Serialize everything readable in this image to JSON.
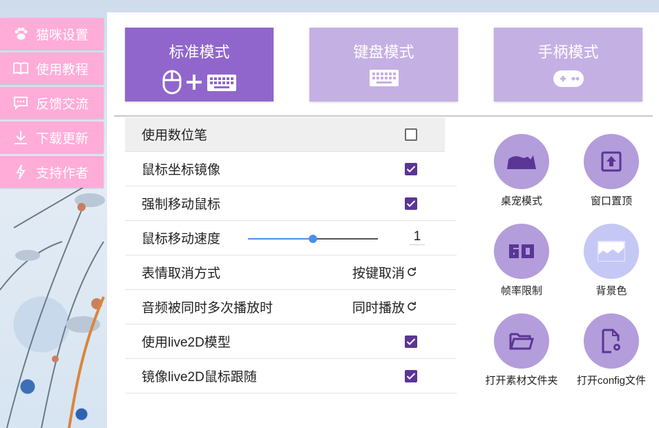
{
  "sidebar": {
    "items": [
      {
        "label": "猫咪设置",
        "icon": "paw-icon"
      },
      {
        "label": "使用教程",
        "icon": "book-icon"
      },
      {
        "label": "反馈交流",
        "icon": "chat-icon"
      },
      {
        "label": "下载更新",
        "icon": "download-icon"
      },
      {
        "label": "支持作者",
        "icon": "lightning-icon"
      }
    ]
  },
  "modes": [
    {
      "label": "标准模式",
      "icon": "mouse-plus-keyboard-icon",
      "state": "active"
    },
    {
      "label": "键盘模式",
      "icon": "keyboard-icon",
      "state": "inactive"
    },
    {
      "label": "手柄模式",
      "icon": "gamepad-icon",
      "state": "inactive"
    }
  ],
  "settings": {
    "pen": {
      "label": "使用数位笔",
      "checked": false
    },
    "mirror": {
      "label": "鼠标坐标镜像",
      "checked": true
    },
    "force_move": {
      "label": "强制移动鼠标",
      "checked": true
    },
    "speed": {
      "label": "鼠标移动速度",
      "value": "1",
      "slider_fraction": 0.5
    },
    "emote_cancel": {
      "label": "表情取消方式",
      "value": "按键取消"
    },
    "audio": {
      "label": "音频被同时多次播放时",
      "value": "同时播放"
    },
    "live2d": {
      "label": "使用live2D模型",
      "checked": true
    },
    "live2d_mirror": {
      "label": "镜像live2D鼠标跟随",
      "checked": true
    }
  },
  "tools": [
    {
      "label": "桌宠模式",
      "icon": "cat-silhouette-icon"
    },
    {
      "label": "窗口置顶",
      "icon": "pin-top-icon"
    },
    {
      "label": "帧率限制",
      "icon": "fps-60-icon"
    },
    {
      "label": "背景色",
      "icon": "image-icon"
    },
    {
      "label": "打开素材文件夹",
      "icon": "folder-open-icon"
    },
    {
      "label": "打开config文件",
      "icon": "file-settings-icon"
    }
  ],
  "colors": {
    "sidebar_pink": "#ffacd8",
    "mode_active": "#9066cc",
    "mode_inactive": "#c5b0e4",
    "checkbox": "#5b3596",
    "tool_circle": "#b39ddb",
    "tool_circle_light": "#c5c8f5",
    "tool_icon": "#5b3596",
    "slider": "#4b8ef0"
  }
}
